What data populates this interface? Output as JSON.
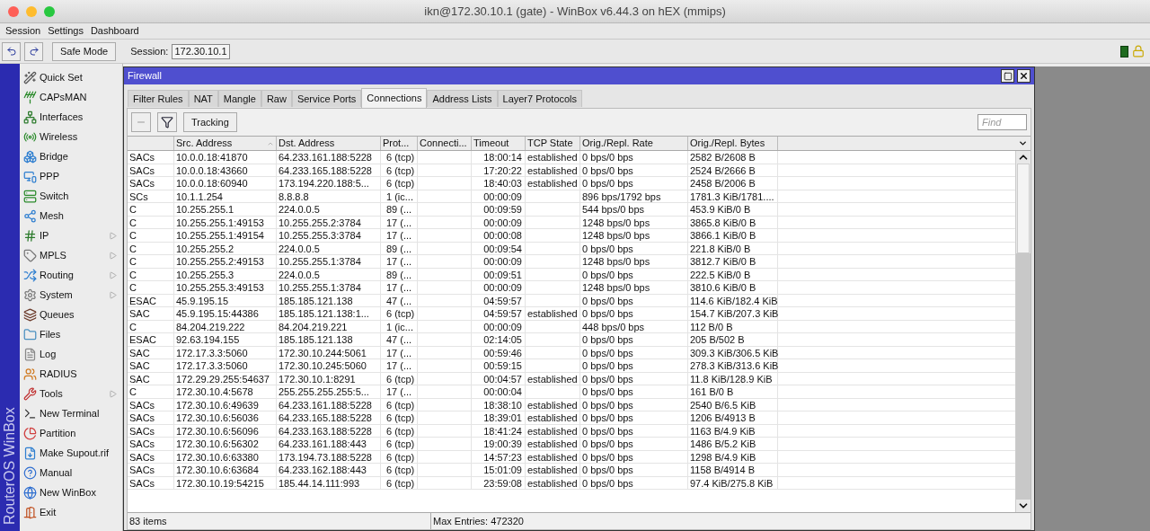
{
  "window": {
    "title": "ikn@172.30.10.1 (gate) - WinBox v6.44.3 on hEX (mmips)"
  },
  "menu": [
    "Session",
    "Settings",
    "Dashboard"
  ],
  "toolbar": {
    "safe_mode": "Safe Mode",
    "session_label": "Session:",
    "session_value": "172.30.10.1"
  },
  "sidebar": {
    "brand": "RouterOS WinBox",
    "items": [
      {
        "label": "Quick Set",
        "submenu": false
      },
      {
        "label": "CAPsMAN",
        "submenu": false
      },
      {
        "label": "Interfaces",
        "submenu": false
      },
      {
        "label": "Wireless",
        "submenu": false
      },
      {
        "label": "Bridge",
        "submenu": false
      },
      {
        "label": "PPP",
        "submenu": false
      },
      {
        "label": "Switch",
        "submenu": false
      },
      {
        "label": "Mesh",
        "submenu": false
      },
      {
        "label": "IP",
        "submenu": true
      },
      {
        "label": "MPLS",
        "submenu": true
      },
      {
        "label": "Routing",
        "submenu": true
      },
      {
        "label": "System",
        "submenu": true
      },
      {
        "label": "Queues",
        "submenu": false
      },
      {
        "label": "Files",
        "submenu": false
      },
      {
        "label": "Log",
        "submenu": false
      },
      {
        "label": "RADIUS",
        "submenu": false
      },
      {
        "label": "Tools",
        "submenu": true
      },
      {
        "label": "New Terminal",
        "submenu": false
      },
      {
        "label": "Partition",
        "submenu": false
      },
      {
        "label": "Make Supout.rif",
        "submenu": false
      },
      {
        "label": "Manual",
        "submenu": false
      },
      {
        "label": "New WinBox",
        "submenu": false
      },
      {
        "label": "Exit",
        "submenu": false
      }
    ]
  },
  "firewall": {
    "title": "Firewall",
    "tabs": [
      {
        "label": "Filter Rules",
        "selected": false
      },
      {
        "label": "NAT",
        "selected": false
      },
      {
        "label": "Mangle",
        "selected": false
      },
      {
        "label": "Raw",
        "selected": false
      },
      {
        "label": "Service Ports",
        "selected": false
      },
      {
        "label": "Connections",
        "selected": true
      },
      {
        "label": "Address Lists",
        "selected": false
      },
      {
        "label": "Layer7 Protocols",
        "selected": false
      }
    ],
    "tracking_button": "Tracking",
    "find_placeholder": "Find",
    "table": {
      "columns": [
        {
          "sorted": false
        },
        {
          "label": "Src. Address",
          "sorted": true
        },
        {
          "label": "Dst. Address",
          "sorted": false
        },
        {
          "label": "Prot...",
          "sorted": false
        },
        {
          "label": "Connecti...",
          "sorted": false
        },
        {
          "label": "Timeout",
          "sorted": false
        },
        {
          "label": "TCP State",
          "sorted": false
        },
        {
          "label": "Orig./Repl. Rate",
          "sorted": false
        },
        {
          "label": "Orig./Repl. Bytes",
          "sorted": false
        }
      ],
      "rows": [
        [
          "SACs",
          "10.0.0.18:41870",
          "64.233.161.188:5228",
          "6 (tcp)",
          "",
          "18:00:14",
          "established",
          "0 bps/0 bps",
          "2582 B/2608 B"
        ],
        [
          "SACs",
          "10.0.0.18:43660",
          "64.233.165.188:5228",
          "6 (tcp)",
          "",
          "17:20:22",
          "established",
          "0 bps/0 bps",
          "2524 B/2666 B"
        ],
        [
          "SACs",
          "10.0.0.18:60940",
          "173.194.220.188:5...",
          "6 (tcp)",
          "",
          "18:40:03",
          "established",
          "0 bps/0 bps",
          "2458 B/2006 B"
        ],
        [
          "SCs",
          "10.1.1.254",
          "8.8.8.8",
          "1 (ic...",
          "",
          "00:00:09",
          "",
          "896 bps/1792 bps",
          "1781.3 KiB/1781...."
        ],
        [
          "C",
          "10.255.255.1",
          "224.0.0.5",
          "89 (...",
          "",
          "00:09:59",
          "",
          "544 bps/0 bps",
          "453.9 KiB/0 B"
        ],
        [
          "C",
          "10.255.255.1:49153",
          "10.255.255.2:3784",
          "17 (...",
          "",
          "00:00:09",
          "",
          "1248 bps/0 bps",
          "3865.8 KiB/0 B"
        ],
        [
          "C",
          "10.255.255.1:49154",
          "10.255.255.3:3784",
          "17 (...",
          "",
          "00:00:08",
          "",
          "1248 bps/0 bps",
          "3866.1 KiB/0 B"
        ],
        [
          "C",
          "10.255.255.2",
          "224.0.0.5",
          "89 (...",
          "",
          "00:09:54",
          "",
          "0 bps/0 bps",
          "221.8 KiB/0 B"
        ],
        [
          "C",
          "10.255.255.2:49153",
          "10.255.255.1:3784",
          "17 (...",
          "",
          "00:00:09",
          "",
          "1248 bps/0 bps",
          "3812.7 KiB/0 B"
        ],
        [
          "C",
          "10.255.255.3",
          "224.0.0.5",
          "89 (...",
          "",
          "00:09:51",
          "",
          "0 bps/0 bps",
          "222.5 KiB/0 B"
        ],
        [
          "C",
          "10.255.255.3:49153",
          "10.255.255.1:3784",
          "17 (...",
          "",
          "00:00:09",
          "",
          "1248 bps/0 bps",
          "3810.6 KiB/0 B"
        ],
        [
          "ESAC",
          "45.9.195.15",
          "185.185.121.138",
          "47 (...",
          "",
          "04:59:57",
          "",
          "0 bps/0 bps",
          "114.6 KiB/182.4 KiB"
        ],
        [
          "SAC",
          "45.9.195.15:44386",
          "185.185.121.138:1...",
          "6 (tcp)",
          "",
          "04:59:57",
          "established",
          "0 bps/0 bps",
          "154.7 KiB/207.3 KiB"
        ],
        [
          "C",
          "84.204.219.222",
          "84.204.219.221",
          "1 (ic...",
          "",
          "00:00:09",
          "",
          "448 bps/0 bps",
          "112 B/0 B"
        ],
        [
          "ESAC",
          "92.63.194.155",
          "185.185.121.138",
          "47 (...",
          "",
          "02:14:05",
          "",
          "0 bps/0 bps",
          "205 B/502 B"
        ],
        [
          "SAC",
          "172.17.3.3:5060",
          "172.30.10.244:5061",
          "17 (...",
          "",
          "00:59:46",
          "",
          "0 bps/0 bps",
          "309.3 KiB/306.5 KiB"
        ],
        [
          "SAC",
          "172.17.3.3:5060",
          "172.30.10.245:5060",
          "17 (...",
          "",
          "00:59:15",
          "",
          "0 bps/0 bps",
          "278.3 KiB/313.6 KiB"
        ],
        [
          "SAC",
          "172.29.29.255:54637",
          "172.30.10.1:8291",
          "6 (tcp)",
          "",
          "00:04:57",
          "established",
          "0 bps/0 bps",
          "11.8 KiB/128.9 KiB"
        ],
        [
          "C",
          "172.30.10.4:5678",
          "255.255.255.255:5...",
          "17 (...",
          "",
          "00:00:04",
          "",
          "0 bps/0 bps",
          "161 B/0 B"
        ],
        [
          "SACs",
          "172.30.10.6:49639",
          "64.233.161.188:5228",
          "6 (tcp)",
          "",
          "18:38:10",
          "established",
          "0 bps/0 bps",
          "2540 B/6.5 KiB"
        ],
        [
          "SACs",
          "172.30.10.6:56036",
          "64.233.165.188:5228",
          "6 (tcp)",
          "",
          "18:39:01",
          "established",
          "0 bps/0 bps",
          "1206 B/4913 B"
        ],
        [
          "SACs",
          "172.30.10.6:56096",
          "64.233.163.188:5228",
          "6 (tcp)",
          "",
          "18:41:24",
          "established",
          "0 bps/0 bps",
          "1163 B/4.9 KiB"
        ],
        [
          "SACs",
          "172.30.10.6:56302",
          "64.233.161.188:443",
          "6 (tcp)",
          "",
          "19:00:39",
          "established",
          "0 bps/0 bps",
          "1486 B/5.2 KiB"
        ],
        [
          "SACs",
          "172.30.10.6:63380",
          "173.194.73.188:5228",
          "6 (tcp)",
          "",
          "14:57:23",
          "established",
          "0 bps/0 bps",
          "1298 B/4.9 KiB"
        ],
        [
          "SACs",
          "172.30.10.6:63684",
          "64.233.162.188:443",
          "6 (tcp)",
          "",
          "15:01:09",
          "established",
          "0 bps/0 bps",
          "1158 B/4914 B"
        ],
        [
          "SACs",
          "172.30.10.19:54215",
          "185.44.14.111:993",
          "6 (tcp)",
          "",
          "23:59:08",
          "established",
          "0 bps/0 bps",
          "97.4 KiB/275.8 KiB"
        ]
      ]
    },
    "status_bar": {
      "items": "83 items",
      "max_entries": "Max Entries: 472320"
    }
  }
}
